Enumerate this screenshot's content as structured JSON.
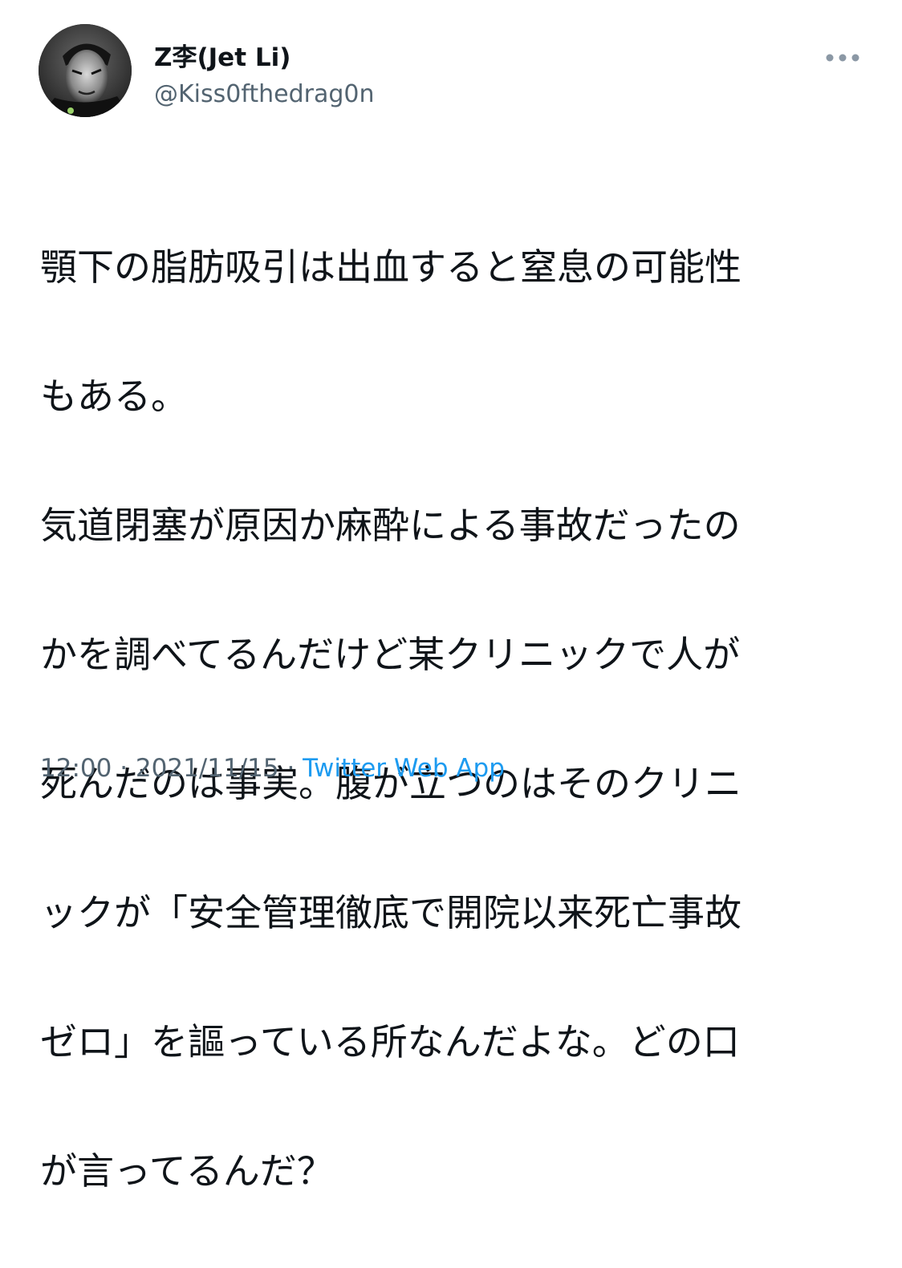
{
  "user": {
    "display_name": "Z李(Jet Li)",
    "handle": "@Kiss0fthedrag0n",
    "avatar_icon": "user-avatar"
  },
  "more_icon": "more-horizontal-icon",
  "tweet": {
    "lines": [
      "顎下の脂肪吸引は出血すると窒息の可能性",
      "もある。",
      "気道閉塞が原因か麻酔による事故だったの",
      "かを調べてるんだけど某クリニックで人が",
      "死んだのは事実。腹が立つのはそのクリニ",
      "ックが「安全管理徹底で開院以来死亡事故",
      "ゼロ」を謳っている所なんだよな。どの口",
      "が言ってるんだ？"
    ]
  },
  "meta": {
    "time": "12:00",
    "separator": " · ",
    "date": "2021/11/15",
    "source": "Twitter Web App"
  },
  "colors": {
    "text": "#0f1419",
    "secondary": "#536471",
    "link": "#1d9bf0"
  }
}
